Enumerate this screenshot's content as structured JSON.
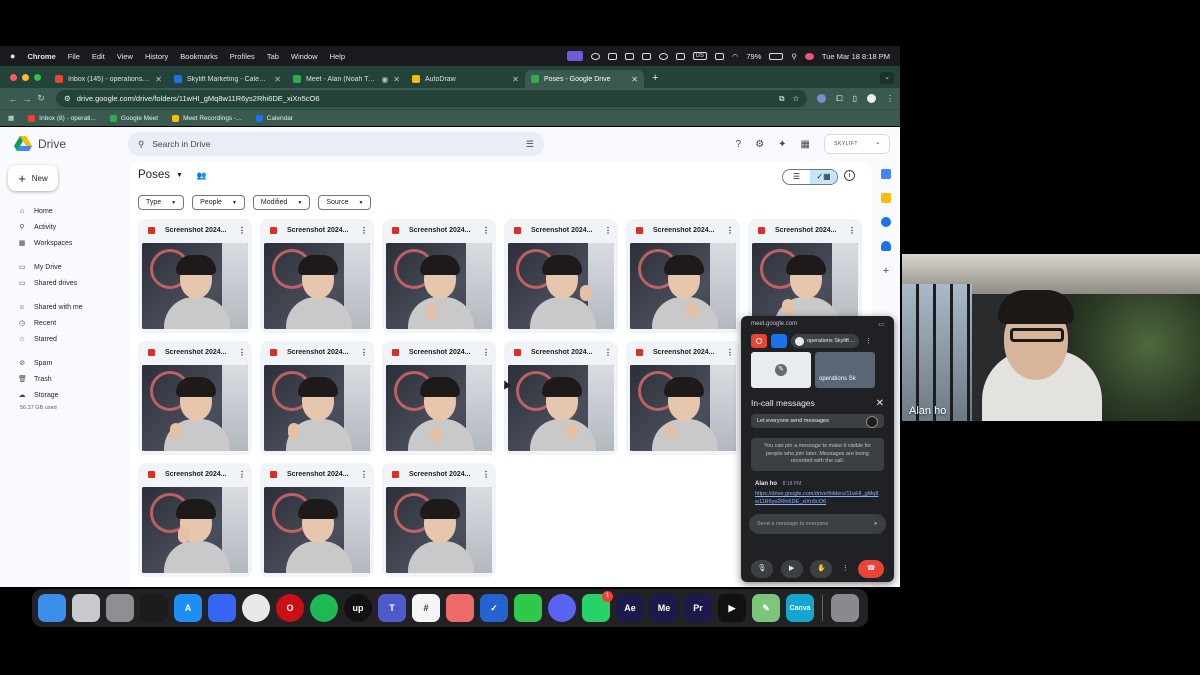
{
  "menubar": {
    "app": "Chrome",
    "items": [
      "File",
      "Edit",
      "View",
      "History",
      "Bookmarks",
      "Profiles",
      "Tab",
      "Window",
      "Help"
    ],
    "battery": "79%",
    "clock": "Tue Mar 18  8:18 PM",
    "input_source": "US"
  },
  "tabs": [
    {
      "label": "Inbox (145) - operations@sky",
      "fav_color": "#ea4335"
    },
    {
      "label": "Skylift Marketing - Calendar",
      "fav_color": "#1a73e8"
    },
    {
      "label": "Meet - Alan (Noah Tactic",
      "fav_color": "#34a853"
    },
    {
      "label": "AutoDraw",
      "fav_color": "#fbbc04"
    },
    {
      "label": "Poses - Google Drive",
      "fav_color": "#34a853"
    }
  ],
  "address": "drive.google.com/drive/folders/11wHI_gMq8w11R6ys2Rhi6DE_xiXn5cO6",
  "bookmarks": [
    {
      "label": "Inbox (8) - operati...",
      "fav_color": "#ea4335"
    },
    {
      "label": "Google Meet",
      "fav_color": "#34a853"
    },
    {
      "label": "Meet Recordings -...",
      "fav_color": "#fbbc04"
    },
    {
      "label": "Calendar",
      "fav_color": "#1a73e8"
    }
  ],
  "drive": {
    "logo": "Drive",
    "search_placeholder": "Search in Drive",
    "new_label": "New",
    "account_label": "SKYLIFT",
    "folder_title": "Poses",
    "nav": [
      {
        "label": "Home",
        "icon": "home-icon",
        "glyph": "⌂"
      },
      {
        "label": "Activity",
        "icon": "activity-icon",
        "glyph": "⚲"
      },
      {
        "label": "Workspaces",
        "icon": "workspaces-icon",
        "glyph": "▦"
      },
      {
        "label": "My Drive",
        "icon": "my-drive-icon",
        "glyph": "▭"
      },
      {
        "label": "Shared drives",
        "icon": "shared-drives-icon",
        "glyph": "▭"
      },
      {
        "label": "Shared with me",
        "icon": "shared-with-me-icon",
        "glyph": "☺"
      },
      {
        "label": "Recent",
        "icon": "recent-icon",
        "glyph": "◷"
      },
      {
        "label": "Starred",
        "icon": "starred-icon",
        "glyph": "☆"
      },
      {
        "label": "Spam",
        "icon": "spam-icon",
        "glyph": "⊘"
      },
      {
        "label": "Trash",
        "icon": "trash-icon",
        "glyph": "🗑"
      },
      {
        "label": "Storage",
        "icon": "storage-icon",
        "glyph": "☁"
      }
    ],
    "storage_used": "56.37 GB used",
    "filters": [
      "Type",
      "People",
      "Modified",
      "Source"
    ],
    "files": [
      "Screenshot 2024...",
      "Screenshot 2024...",
      "Screenshot 2024...",
      "Screenshot 2024...",
      "Screenshot 2024...",
      "Screenshot 2024...",
      "Screenshot 2024...",
      "Screenshot 2024...",
      "Screenshot 2024...",
      "Screenshot 2024...",
      "Screenshot 2024...",
      "Screenshot 2024...",
      "Screenshot 2024...",
      "Screenshot 2024...",
      "Screenshot 2024..."
    ]
  },
  "meet": {
    "host": "meet.google.com",
    "account": "operations Skylift ...",
    "tile_label": "operations Sk",
    "panel_title": "In-call messages",
    "toggle_label": "Let everyone send messages",
    "pin_info": "You can pin a message to make it visible for people who join later. Messages are being recorded with the call.",
    "message": {
      "sender": "Alan ho",
      "time": "8:18 PM",
      "text": "https://drive.google.com/drive/folders/11wHI_gMq8w11R6ys2Rhi6DE_xiXn5cO6"
    },
    "compose_placeholder": "Send a message to everyone"
  },
  "dock": [
    {
      "name": "finder",
      "label": "",
      "bg": "#3b8fe8"
    },
    {
      "name": "launchpad",
      "label": "",
      "bg": "#c9c9cf"
    },
    {
      "name": "system-settings",
      "label": "",
      "bg": "#8e8e93"
    },
    {
      "name": "activity-monitor",
      "label": "",
      "bg": "#1c1c1c"
    },
    {
      "name": "app-store",
      "label": "A",
      "bg": "#1c8ef6"
    },
    {
      "name": "arc",
      "label": "",
      "bg": "#3566f2"
    },
    {
      "name": "chrome",
      "label": "",
      "bg": "#e8e8e8"
    },
    {
      "name": "opera",
      "label": "O",
      "bg": "#cc0f16"
    },
    {
      "name": "spotify",
      "label": "",
      "bg": "#1db954"
    },
    {
      "name": "upwork",
      "label": "up",
      "bg": "#111111"
    },
    {
      "name": "teams",
      "label": "T",
      "bg": "#5059c9"
    },
    {
      "name": "slack",
      "label": "#",
      "bg": "#f5f5f5"
    },
    {
      "name": "asana",
      "label": "",
      "bg": "#f06a6a"
    },
    {
      "name": "todo",
      "label": "✓",
      "bg": "#2564cf"
    },
    {
      "name": "facetime",
      "label": "",
      "bg": "#2fc84a"
    },
    {
      "name": "discord",
      "label": "",
      "bg": "#5865f2"
    },
    {
      "name": "whatsapp",
      "label": "",
      "bg": "#25d366",
      "badge": "1"
    },
    {
      "name": "after-effects",
      "label": "Ae",
      "bg": "#1c1a4a"
    },
    {
      "name": "media-encoder",
      "label": "Me",
      "bg": "#1c1a4a"
    },
    {
      "name": "premiere-pro",
      "label": "Pr",
      "bg": "#1c1a4a"
    },
    {
      "name": "video-tool",
      "label": "▶",
      "bg": "#111111"
    },
    {
      "name": "autodraw",
      "label": "✎",
      "bg": "#7bc67b"
    },
    {
      "name": "canva",
      "label": "Canva",
      "bg": "#15a6cf"
    },
    {
      "name": "trash",
      "label": "",
      "bg": "#8a8a8e"
    }
  ],
  "webcam": {
    "name": "Alan ho"
  },
  "colors": {
    "chrome_frame": "#3a5a50",
    "drive_bg": "#f8fafd",
    "meet_bg": "#202124",
    "end_call": "#ea4335"
  }
}
